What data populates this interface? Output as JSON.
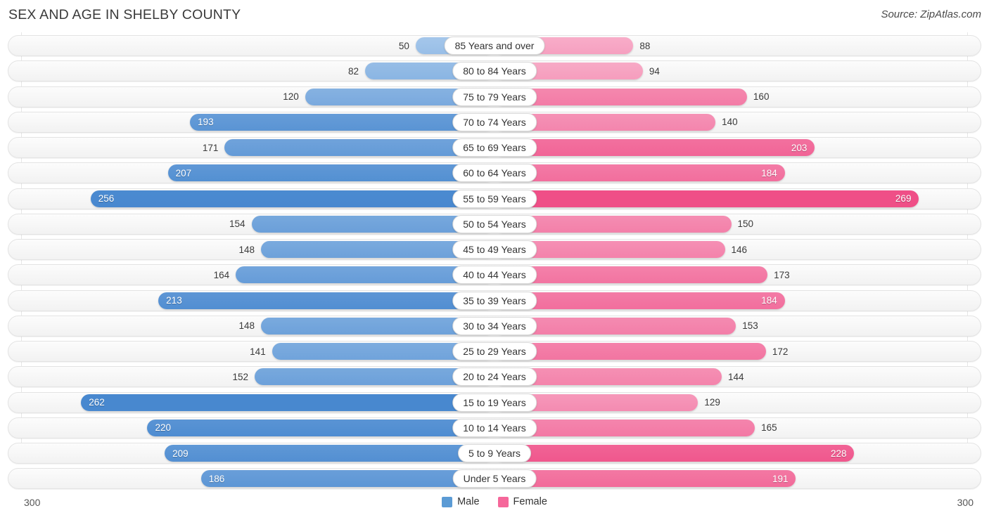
{
  "header": {
    "title": "SEX AND AGE IN SHELBY COUNTY",
    "source": "Source: ZipAtlas.com"
  },
  "axis": {
    "left_max_label": "300",
    "right_max_label": "300"
  },
  "legend": {
    "male_label": "Male",
    "female_label": "Female",
    "male_color": "#5b9bd5",
    "female_color": "#f5679a"
  },
  "chart_data": {
    "type": "bar",
    "title": "SEX AND AGE IN SHELBY COUNTY",
    "subtitle": "Source: ZipAtlas.com",
    "orientation": "horizontal-diverging",
    "xlabel": "",
    "ylabel": "",
    "xlim": [
      300,
      300
    ],
    "grid": false,
    "legend_position": "bottom-center",
    "categories": [
      "85 Years and over",
      "80 to 84 Years",
      "75 to 79 Years",
      "70 to 74 Years",
      "65 to 69 Years",
      "60 to 64 Years",
      "55 to 59 Years",
      "50 to 54 Years",
      "45 to 49 Years",
      "40 to 44 Years",
      "35 to 39 Years",
      "30 to 34 Years",
      "25 to 29 Years",
      "20 to 24 Years",
      "15 to 19 Years",
      "10 to 14 Years",
      "5 to 9 Years",
      "Under 5 Years"
    ],
    "series": [
      {
        "name": "Male",
        "color": "#5b9bd5",
        "values": [
          50,
          82,
          120,
          193,
          171,
          207,
          256,
          154,
          148,
          164,
          213,
          148,
          141,
          152,
          262,
          220,
          209,
          186
        ]
      },
      {
        "name": "Female",
        "color": "#f5679a",
        "values": [
          88,
          94,
          160,
          140,
          203,
          184,
          269,
          150,
          146,
          173,
          184,
          153,
          172,
          144,
          129,
          165,
          228,
          191
        ]
      }
    ]
  },
  "rows": [
    {
      "age": "85 Years and over",
      "male": 50,
      "female": 88,
      "male_inside": false,
      "female_inside": false
    },
    {
      "age": "80 to 84 Years",
      "male": 82,
      "female": 94,
      "male_inside": false,
      "female_inside": false
    },
    {
      "age": "75 to 79 Years",
      "male": 120,
      "female": 160,
      "male_inside": false,
      "female_inside": false
    },
    {
      "age": "70 to 74 Years",
      "male": 193,
      "female": 140,
      "male_inside": true,
      "female_inside": false
    },
    {
      "age": "65 to 69 Years",
      "male": 171,
      "female": 203,
      "male_inside": false,
      "female_inside": true
    },
    {
      "age": "60 to 64 Years",
      "male": 207,
      "female": 184,
      "male_inside": true,
      "female_inside": true
    },
    {
      "age": "55 to 59 Years",
      "male": 256,
      "female": 269,
      "male_inside": true,
      "female_inside": true
    },
    {
      "age": "50 to 54 Years",
      "male": 154,
      "female": 150,
      "male_inside": false,
      "female_inside": false
    },
    {
      "age": "45 to 49 Years",
      "male": 148,
      "female": 146,
      "male_inside": false,
      "female_inside": false
    },
    {
      "age": "40 to 44 Years",
      "male": 164,
      "female": 173,
      "male_inside": false,
      "female_inside": false
    },
    {
      "age": "35 to 39 Years",
      "male": 213,
      "female": 184,
      "male_inside": true,
      "female_inside": true
    },
    {
      "age": "30 to 34 Years",
      "male": 148,
      "female": 153,
      "male_inside": false,
      "female_inside": false
    },
    {
      "age": "25 to 29 Years",
      "male": 141,
      "female": 172,
      "male_inside": false,
      "female_inside": false
    },
    {
      "age": "20 to 24 Years",
      "male": 152,
      "female": 144,
      "male_inside": false,
      "female_inside": false
    },
    {
      "age": "15 to 19 Years",
      "male": 262,
      "female": 129,
      "male_inside": true,
      "female_inside": false
    },
    {
      "age": "10 to 14 Years",
      "male": 220,
      "female": 165,
      "male_inside": true,
      "female_inside": false
    },
    {
      "age": "5 to 9 Years",
      "male": 209,
      "female": 228,
      "male_inside": true,
      "female_inside": true
    },
    {
      "age": "Under 5 Years",
      "male": 186,
      "female": 191,
      "male_inside": true,
      "female_inside": true
    }
  ]
}
